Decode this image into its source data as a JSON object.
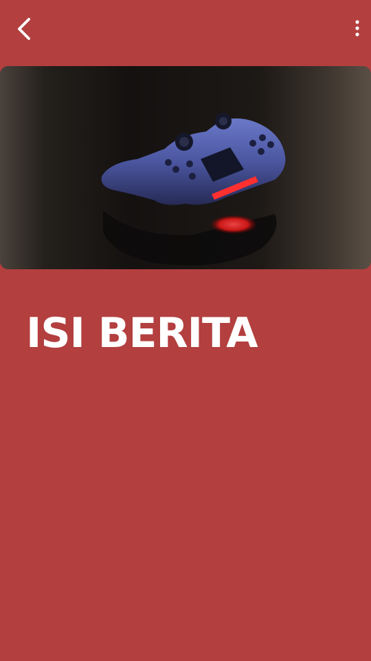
{
  "appbar": {
    "back_icon": "chevron-left-icon",
    "menu_icon": "more-vertical-icon"
  },
  "hero_image": {
    "subject": "game-controller-photo"
  },
  "article": {
    "title": "ISI BERITA"
  },
  "colors": {
    "background": "#b33f3f",
    "text": "#ffffff"
  }
}
